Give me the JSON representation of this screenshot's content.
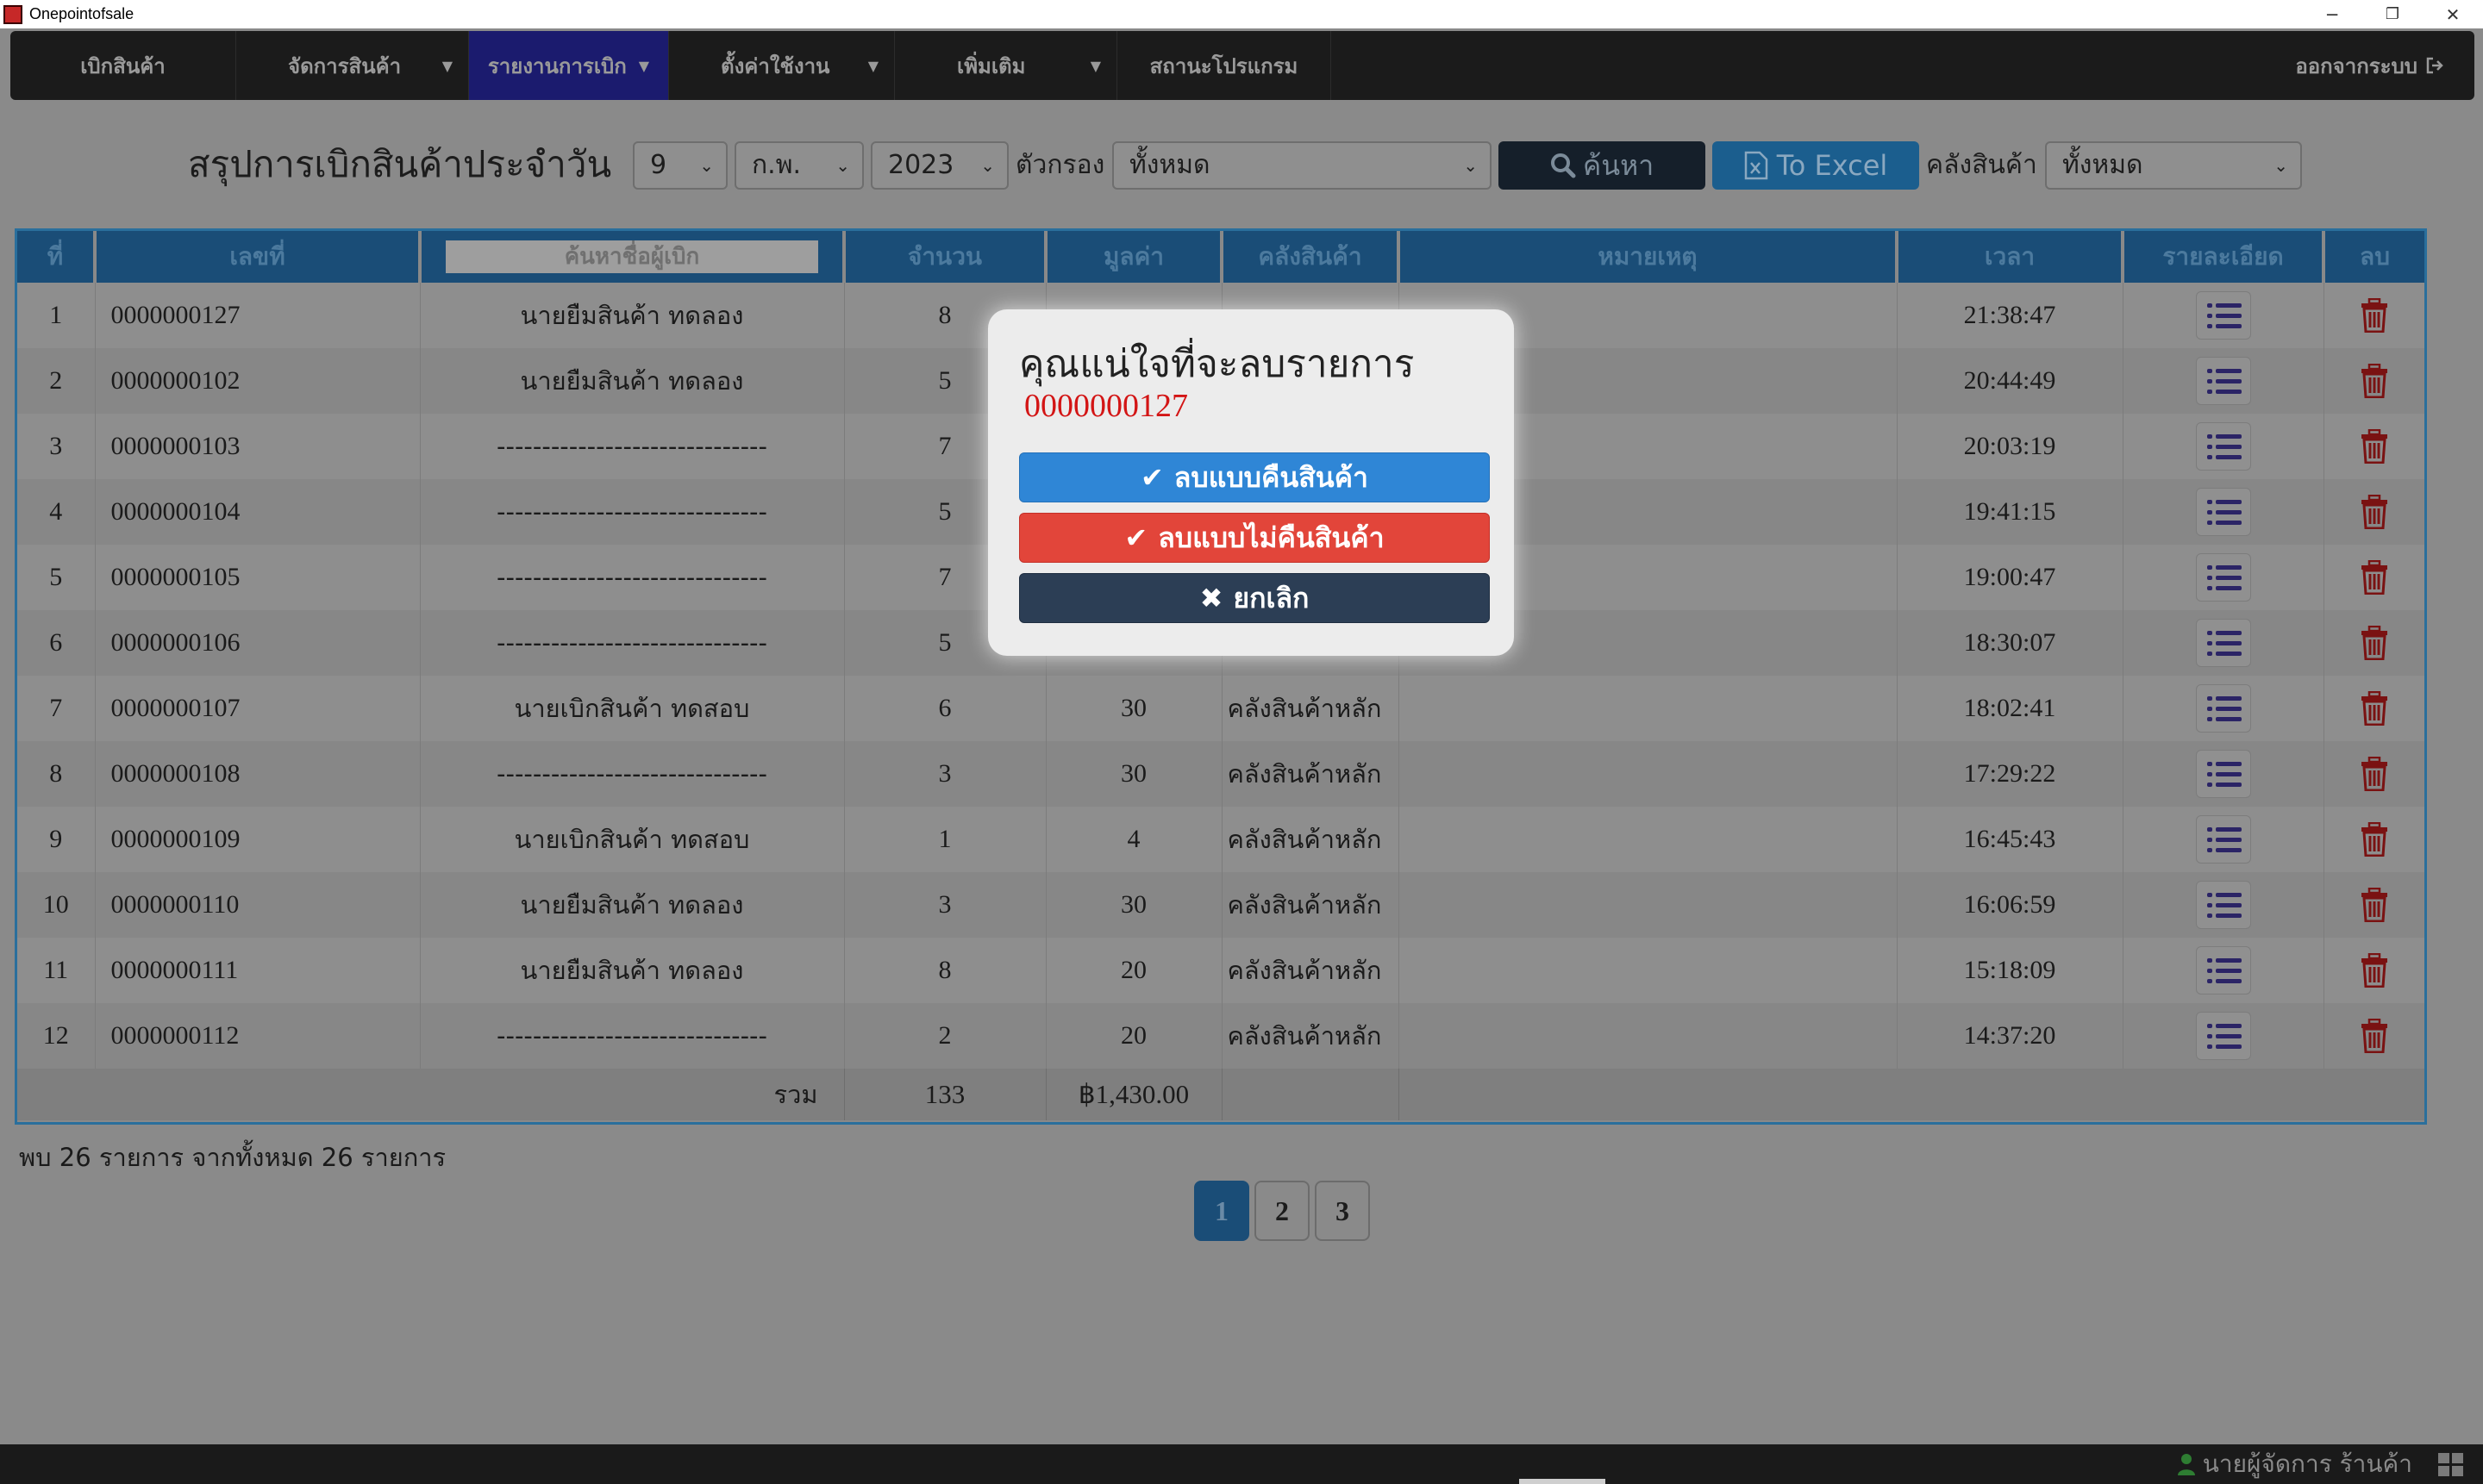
{
  "window": {
    "title": "Onepointofsale",
    "minimize": "─",
    "maximize": "❐",
    "close": "✕"
  },
  "navbar": {
    "items": [
      {
        "label": "เบิกสินค้า"
      },
      {
        "label": "จัดการสินค้า"
      },
      {
        "label": "รายงานการเบิก"
      },
      {
        "label": "ตั้งค่าใช้งาน"
      },
      {
        "label": "เพิ่มเติม"
      },
      {
        "label": "สถานะโปรแกรม"
      }
    ],
    "logout": "ออกจากระบบ"
  },
  "filters": {
    "title": "สรุปการเบิกสินค้าประจำวัน",
    "day": "9",
    "month": "ก.พ.",
    "year": "2023",
    "filter_label": "ตัวกรอง",
    "filter_value": "ทั้งหมด",
    "search_button": "ค้นหา",
    "excel_button": "To Excel",
    "warehouse_label": "คลังสินค้า",
    "warehouse_value": "ทั้งหมด"
  },
  "table": {
    "headers": {
      "no": "ที่",
      "doc": "เลขที่",
      "search_placeholder": "ค้นหาชื่อผู้เบิก",
      "qty": "จำนวน",
      "value": "มูลค่า",
      "warehouse": "คลังสินค้า",
      "note": "หมายเหตุ",
      "time": "เวลา",
      "detail": "รายละเอียด",
      "delete": "ลบ"
    },
    "rows": [
      {
        "no": "1",
        "doc": "0000000127",
        "name": "นายยืมสินค้า ทดลอง",
        "qty": "8",
        "value": "",
        "wh": "",
        "time": "21:38:47"
      },
      {
        "no": "2",
        "doc": "0000000102",
        "name": "นายยืมสินค้า ทดลอง",
        "qty": "5",
        "value": "",
        "wh": "",
        "time": "20:44:49"
      },
      {
        "no": "3",
        "doc": "0000000103",
        "name": "------------------------------",
        "qty": "7",
        "value": "",
        "wh": "",
        "time": "20:03:19"
      },
      {
        "no": "4",
        "doc": "0000000104",
        "name": "------------------------------",
        "qty": "5",
        "value": "",
        "wh": "",
        "time": "19:41:15"
      },
      {
        "no": "5",
        "doc": "0000000105",
        "name": "------------------------------",
        "qty": "7",
        "value": "",
        "wh": "",
        "time": "19:00:47"
      },
      {
        "no": "6",
        "doc": "0000000106",
        "name": "------------------------------",
        "qty": "5",
        "value": "",
        "wh": "",
        "time": "18:30:07"
      },
      {
        "no": "7",
        "doc": "0000000107",
        "name": "นายเบิกสินค้า ทดสอบ",
        "qty": "6",
        "value": "30",
        "wh": "คลังสินค้าหลัก",
        "time": "18:02:41"
      },
      {
        "no": "8",
        "doc": "0000000108",
        "name": "------------------------------",
        "qty": "3",
        "value": "30",
        "wh": "คลังสินค้าหลัก",
        "time": "17:29:22"
      },
      {
        "no": "9",
        "doc": "0000000109",
        "name": "นายเบิกสินค้า ทดสอบ",
        "qty": "1",
        "value": "4",
        "wh": "คลังสินค้าหลัก",
        "time": "16:45:43"
      },
      {
        "no": "10",
        "doc": "0000000110",
        "name": "นายยืมสินค้า ทดลอง",
        "qty": "3",
        "value": "30",
        "wh": "คลังสินค้าหลัก",
        "time": "16:06:59"
      },
      {
        "no": "11",
        "doc": "0000000111",
        "name": "นายยืมสินค้า ทดลอง",
        "qty": "8",
        "value": "20",
        "wh": "คลังสินค้าหลัก",
        "time": "15:18:09"
      },
      {
        "no": "12",
        "doc": "0000000112",
        "name": "------------------------------",
        "qty": "2",
        "value": "20",
        "wh": "คลังสินค้าหลัก",
        "time": "14:37:20"
      }
    ],
    "footer": {
      "label": "รวม",
      "qty": "133",
      "value": "฿1,430.00"
    }
  },
  "found_text": "พบ 26 รายการ จากทั้งหมด 26 รายการ",
  "pagination": {
    "pages": [
      "1",
      "2",
      "3"
    ],
    "current": "1"
  },
  "status": {
    "user": "นายผู้จัดการ ร้านค้า"
  },
  "modal": {
    "title": "คุณแน่ใจที่จะลบรายการ",
    "doc_no": "0000000127",
    "btn_return": "ลบแบบคืนสินค้า",
    "btn_no_return": "ลบแบบไม่คืนสินค้า",
    "btn_cancel": "ยกเลิก"
  },
  "colors": {
    "header_bg": "#1a4d77",
    "return_button": "#2f86d6",
    "no_return_button": "#e2453a",
    "cancel_button": "#2c3e55",
    "doc_code": "#d31515"
  }
}
